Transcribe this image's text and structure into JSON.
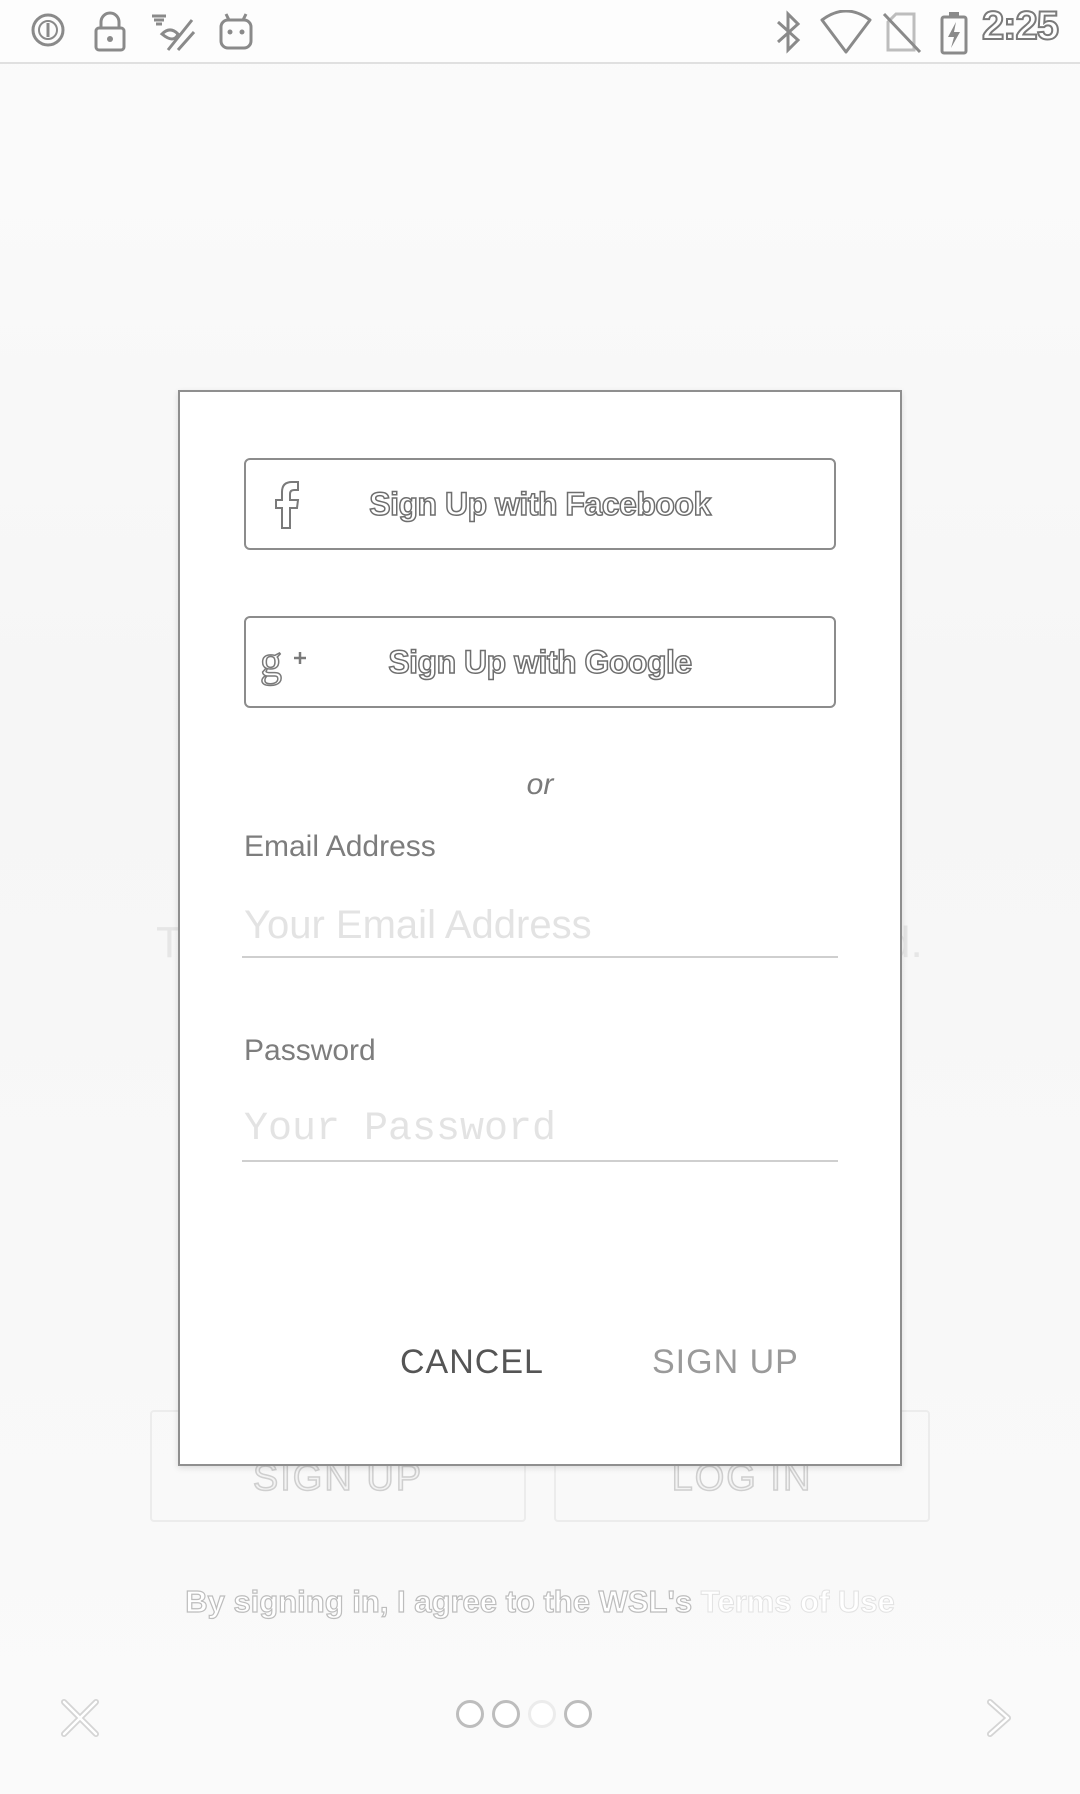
{
  "status_bar": {
    "time": "2:25",
    "icons": [
      "circle-i-icon",
      "lock-icon",
      "food-icon",
      "android-icon",
      "bluetooth-icon",
      "wifi-icon",
      "no-sim-icon",
      "battery-charging-icon"
    ]
  },
  "background": {
    "left_fragment": "T",
    "right_fragment": "d.",
    "signup_button": "SIGN UP",
    "login_button": "LOG IN",
    "terms_prefix": "By signing in, I agree to the WSL's ",
    "terms_link": "Terms of Use",
    "pagination": {
      "count": 4,
      "active": 2
    }
  },
  "dialog": {
    "facebook_button": "Sign Up with Facebook",
    "google_button": "Sign Up with Google",
    "or": "or",
    "email_label": "Email Address",
    "email_placeholder": "Your Email Address",
    "password_label": "Password",
    "password_placeholder": "Your Password",
    "cancel_button": "CANCEL",
    "signup_button": "SIGN UP"
  }
}
